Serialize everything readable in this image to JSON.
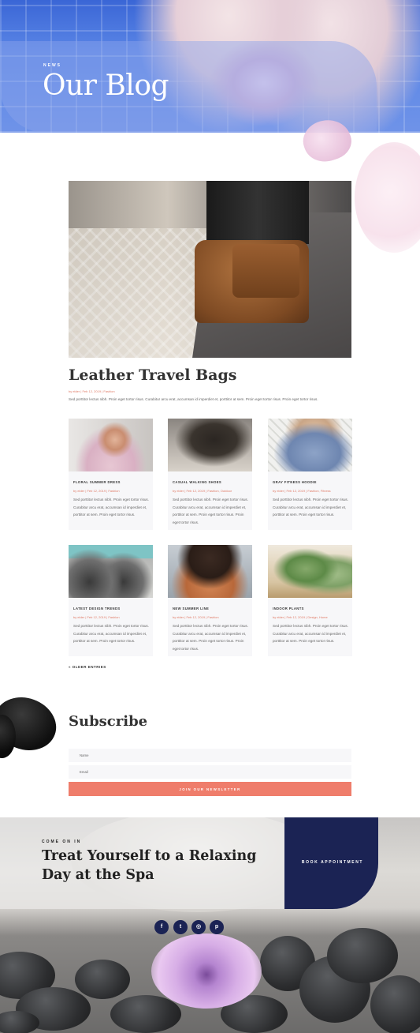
{
  "hero": {
    "eyebrow": "NEWS",
    "title": "Our Blog"
  },
  "featured": {
    "title": "Leather Travel Bags",
    "meta": "by elder | Feb 12, 2019 | Fashion",
    "excerpt": "Sed porttitor lectus nibh. Proin eget tortor risus. Curabitur arcu erat, accumsan id imperdiet et, porttitor at sem. Proin eget tortor risus. Proin eget tortor risus."
  },
  "posts": [
    {
      "title": "FLORAL SUMMER DRESS",
      "meta": "by elder | Feb 12, 2019 | Fashion",
      "excerpt": "Sed porttitor lectus nibh. Proin eget tortor risus. Curabitur arcu erat, accumsan id imperdiet et, porttitor at sem. Proin eget tortor risus."
    },
    {
      "title": "CASUAL WALKING SHOES",
      "meta": "by elder | Feb 12, 2019 | Fashion, Outdoor",
      "excerpt": "Sed porttitor lectus nibh. Proin eget tortor risus. Curabitur arcu erat, accumsan id imperdiet et, porttitor at sem. Proin eget tortor risus. Proin eget tortor risus."
    },
    {
      "title": "GRAY FITNESS HOODIE",
      "meta": "by elder | Feb 12, 2019 | Fashion, Fitness",
      "excerpt": "Sed porttitor lectus nibh. Proin eget tortor risus. Curabitur arcu erat, accumsan id imperdiet et, porttitor at sem. Proin eget tortor risus."
    },
    {
      "title": "LATEST DESIGN TRENDS",
      "meta": "by elder | Feb 12, 2019 | Fashion",
      "excerpt": "Sed porttitor lectus nibh. Proin eget tortor risus. Curabitur arcu erat, accumsan id imperdiet et, porttitor at sem. Proin eget tortor risus."
    },
    {
      "title": "NEW SUMMER LINE",
      "meta": "by elder | Feb 12, 2019 | Fashion",
      "excerpt": "Sed porttitor lectus nibh. Proin eget tortor risus. Curabitur arcu erat, accumsan id imperdiet et, porttitor at sem. Proin eget tortor risus. Proin eget tortor risus."
    },
    {
      "title": "INDOOR PLANTS",
      "meta": "by elder | Feb 12, 2019 | Design, Home",
      "excerpt": "Sed porttitor lectus nibh. Proin eget tortor risus. Curabitur arcu erat, accumsan id imperdiet et, porttitor at sem. Proin eget tortor risus."
    }
  ],
  "pagination": {
    "older": "« OLDER ENTRIES"
  },
  "subscribe": {
    "title": "Subscribe",
    "name_placeholder": "Name",
    "email_placeholder": "Email",
    "button": "JOIN OUR NEWSLETTER"
  },
  "cta": {
    "eyebrow": "COME ON IN",
    "title": "Treat Yourself to a Relaxing Day at the Spa",
    "button": "BOOK APPOINTMENT"
  },
  "social": [
    {
      "icon": "facebook-icon",
      "glyph": "f"
    },
    {
      "icon": "twitter-icon",
      "glyph": "t"
    },
    {
      "icon": "instagram-icon",
      "glyph": "◎"
    },
    {
      "icon": "pinterest-icon",
      "glyph": "p"
    }
  ],
  "colors": {
    "accent": "#ef7d6b",
    "navy": "#1b2354",
    "hero_blue": "#4a74de"
  }
}
